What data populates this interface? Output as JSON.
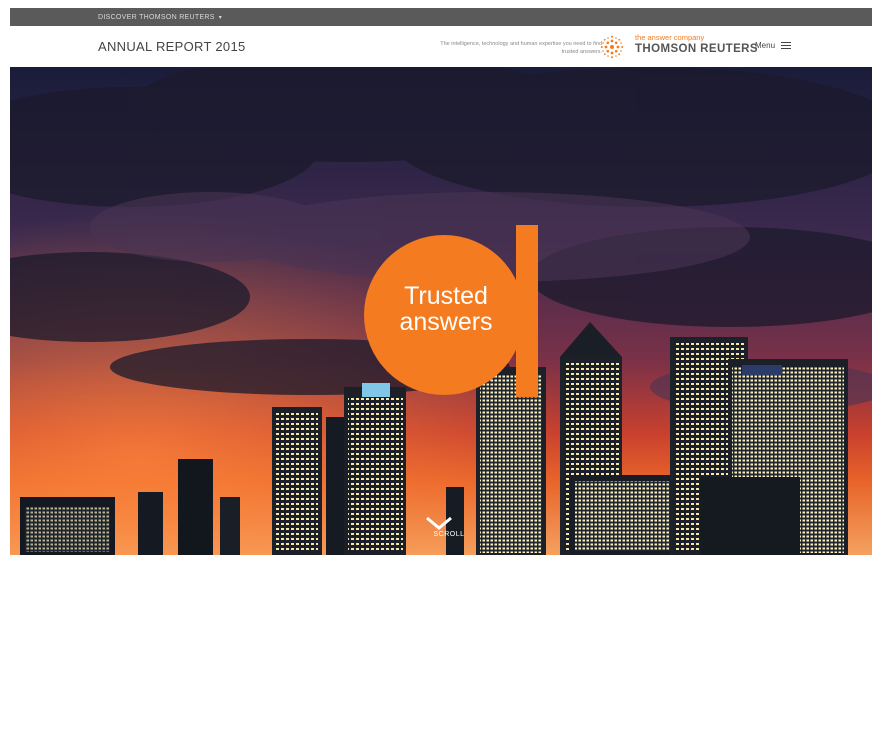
{
  "topbar": {
    "discover_label": "DISCOVER THOMSON REUTERS",
    "caret": "▾"
  },
  "header": {
    "title": "ANNUAL REPORT 2015",
    "tagline": "The intelligence, technology and human expertise you need to find trusted answers.",
    "logo_subtitle": "the answer company",
    "logo_name": "THOMSON REUTERS",
    "menu_label": "Menu"
  },
  "hero": {
    "headline_line1": "Trusted",
    "headline_line2": "answers",
    "scroll_label": "SCROLL"
  },
  "colors": {
    "accent": "#f47b20",
    "topbar": "#5a5a5a"
  },
  "icons": [
    "thomson-reuters-logo-icon",
    "menu-icon",
    "chevron-down-icon"
  ]
}
